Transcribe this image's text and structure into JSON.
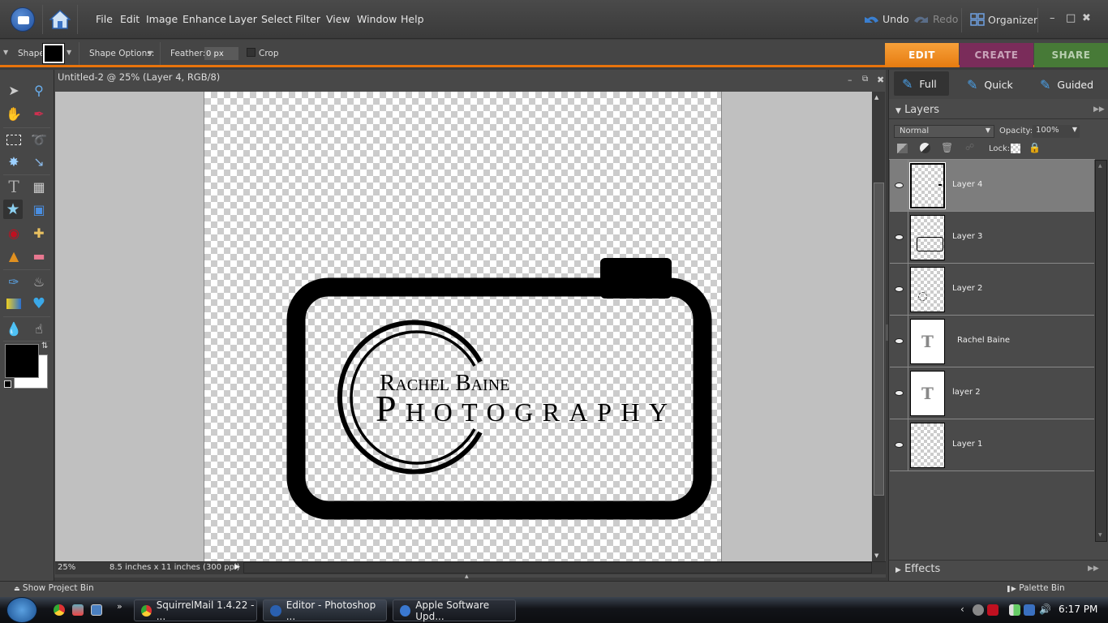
{
  "menubar": {
    "items": [
      "File",
      "Edit",
      "Image",
      "Enhance",
      "Layer",
      "Select",
      "Filter",
      "View",
      "Window",
      "Help"
    ],
    "undo": "Undo",
    "redo": "Redo",
    "organizer": "Organizer"
  },
  "options": {
    "shape_label": "Shape:",
    "shape_options_label": "Shape Options:",
    "feather_label": "Feather:",
    "feather_value": "0 px",
    "crop_label": "Crop"
  },
  "mode_tabs": {
    "edit": "EDIT",
    "create": "CREATE",
    "share": "SHARE"
  },
  "edit_modes": {
    "full": "Full",
    "quick": "Quick",
    "guided": "Guided"
  },
  "document": {
    "title": "Untitled-2 @ 25% (Layer 4, RGB/8)",
    "zoom": "25%",
    "size": "8.5 inches x 11 inches (300 ppi)",
    "logo_line1": "Rachel Baine",
    "logo_line2": "Photography"
  },
  "layers_panel": {
    "title": "Layers",
    "blend_mode": "Normal",
    "opacity_label": "Opacity:",
    "opacity_value": "100%",
    "lock_label": "Lock:",
    "layers": [
      {
        "name": "Layer 4",
        "type": "raster",
        "selected": true,
        "visible": true
      },
      {
        "name": "Layer 3",
        "type": "raster",
        "selected": false,
        "visible": true
      },
      {
        "name": "Layer 2",
        "type": "raster",
        "selected": false,
        "visible": true
      },
      {
        "name": "Rachel Baine",
        "type": "text",
        "selected": false,
        "visible": true
      },
      {
        "name": "layer 2",
        "type": "text",
        "selected": false,
        "visible": true
      },
      {
        "name": "Layer 1",
        "type": "raster",
        "selected": false,
        "visible": true
      }
    ]
  },
  "effects_panel": {
    "title": "Effects"
  },
  "bottom_bar": {
    "show_project_bin": "Show Project Bin",
    "palette_bin": "Palette Bin"
  },
  "taskbar": {
    "tasks": [
      "SquirrelMail 1.4.22 - ...",
      "Editor - Photoshop ...",
      "Apple Software Upd..."
    ],
    "clock": "6:17 PM"
  },
  "colors": {
    "accent": "#e8730c",
    "edit_tab": "#f08a1f",
    "create_tab": "#7a2c5a",
    "share_tab": "#477a37",
    "foreground": "#000000",
    "background": "#ffffff"
  }
}
